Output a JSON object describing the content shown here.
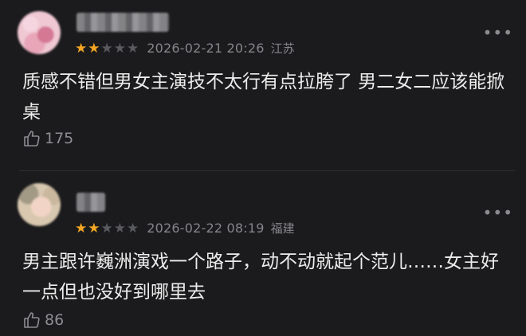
{
  "comments": [
    {
      "stars_filled": 2,
      "stars_total": 5,
      "date": "2026-02-21 20:26",
      "location": "江苏",
      "text": "质感不错但男女主演技不太行有点拉胯了 男二女二应该能掀桌",
      "likes": "175"
    },
    {
      "stars_filled": 2,
      "stars_total": 5,
      "date": "2026-02-22 08:19",
      "location": "福建",
      "text": "男主跟许巍洲演戏一个路子，动不动就起个范儿……女主好一点但也没好到哪里去",
      "likes": "86"
    }
  ],
  "icons": {
    "like": "thumbs-up-icon",
    "more": "more-dots-icon",
    "star": "star-icon"
  },
  "colors": {
    "background": "#1b1b1d",
    "star_filled": "#f4a623",
    "star_empty": "#595a5e",
    "meta_text": "#85858a",
    "body_text": "#ececec"
  }
}
